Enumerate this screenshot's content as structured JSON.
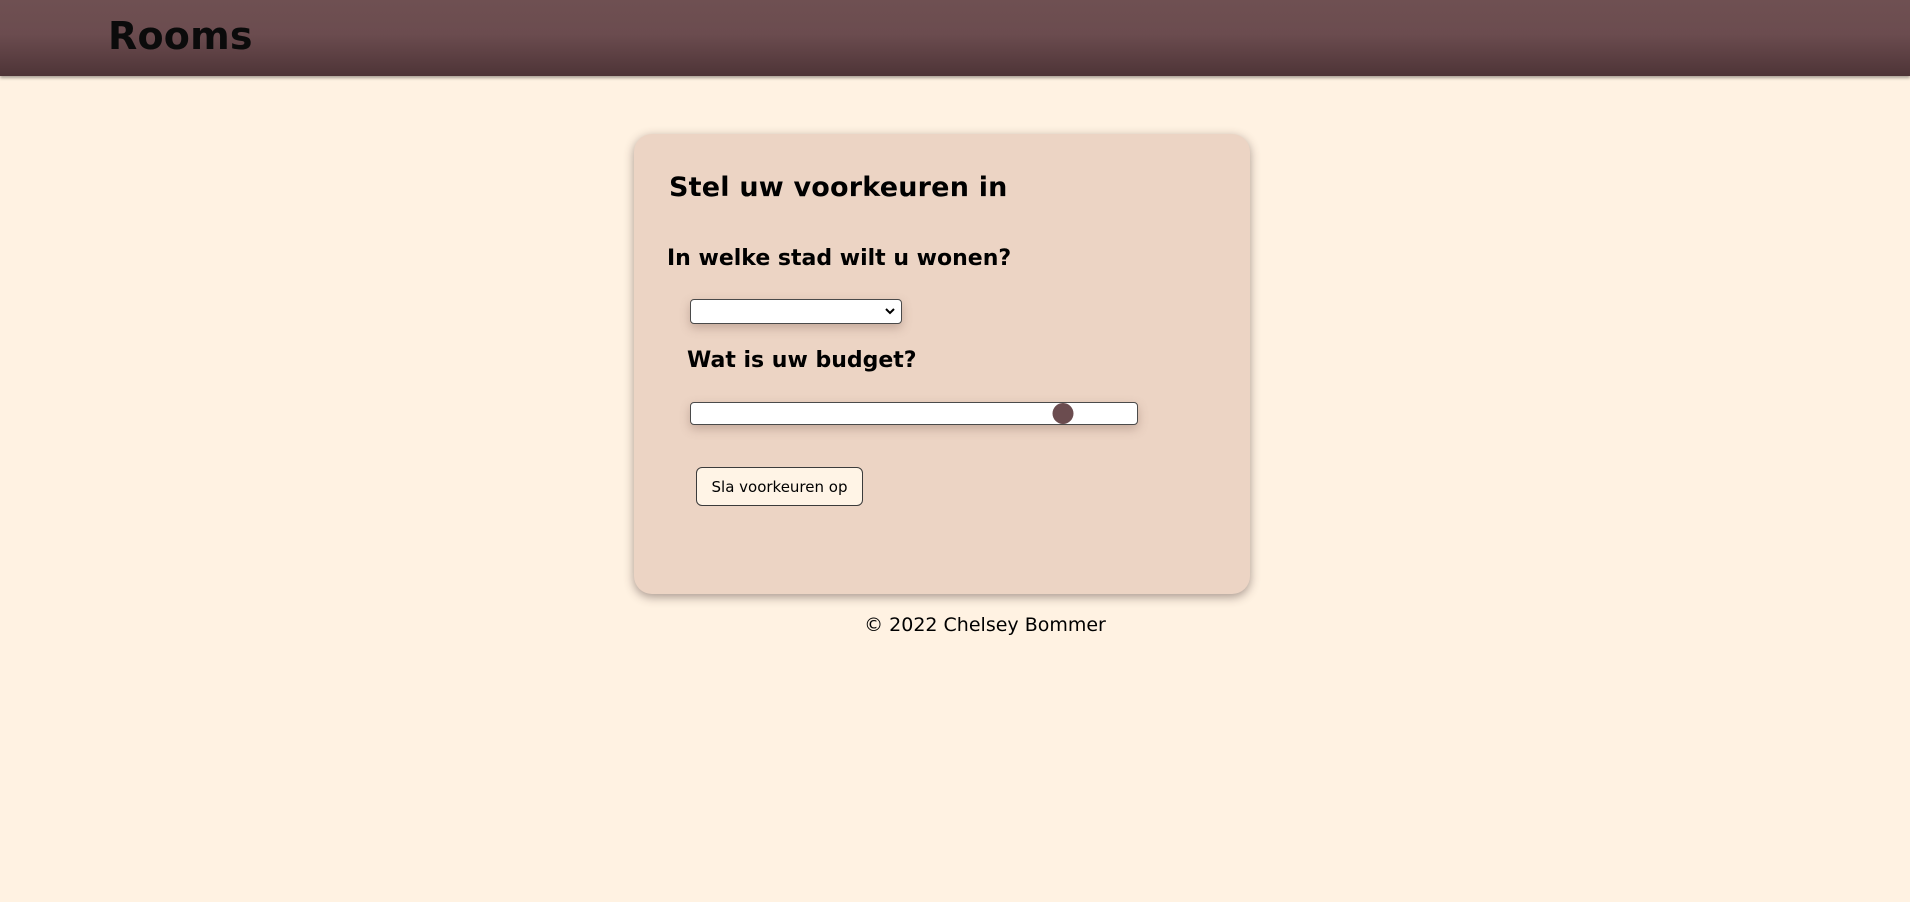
{
  "header": {
    "brand": "Rooms",
    "color": "#6b4c4f"
  },
  "preferences": {
    "title": "Stel uw voorkeuren in",
    "city_question": "In welke stad wilt u wonen?",
    "city_selected": "",
    "budget_question": "Wat is uw budget?",
    "budget_level_fraction": 0.835,
    "save_label": "Sla voorkeuren op"
  },
  "footer": {
    "text": "© 2022 Chelsey Bommer"
  },
  "colors": {
    "page_background": "#fff2e2",
    "card_background": "#ecd4c4",
    "accent": "#6b4c4f"
  },
  "icons": {
    "select_arrow": "chevron-down-icon"
  }
}
